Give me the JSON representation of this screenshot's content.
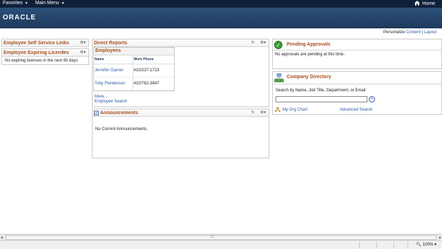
{
  "topbar": {
    "favorites": "Favorites",
    "main_menu": "Main Menu",
    "home": "Home"
  },
  "brand": {
    "logo": "ORACLE"
  },
  "personalize": {
    "label": "Personalize",
    "content": "Content",
    "separator": "|",
    "layout": "Layout"
  },
  "ess_links": {
    "title": "Employee Self Service Links"
  },
  "expiring": {
    "title": "Employee Expiring Licenses",
    "message": "No expiring licenses in the next 60 days"
  },
  "direct_reports": {
    "title": "Direct Reports",
    "table_title": "Employees",
    "columns": [
      "Name",
      "Work Phone"
    ],
    "rows": [
      {
        "name": "Jennifer Garner",
        "phone": "410/237-1723"
      },
      {
        "name": "Toby Flenderson",
        "phone": "410/762-3847"
      }
    ],
    "more": "More...",
    "employee_search": "Employee Search"
  },
  "announcements": {
    "title": "Announcements",
    "message": "No Current Announcements."
  },
  "pending": {
    "title": "Pending Approvals",
    "message": "No approvals are pending at this time."
  },
  "directory": {
    "title": "Company Directory",
    "search_label": "Search by Name, Job Title, Department, or Email",
    "my_org_chart": "My Org Chart",
    "advanced_search": "Advanced Search"
  },
  "statusbar": {
    "zoom": "100%"
  },
  "colors": {
    "topbar": "#11203a",
    "brand": "#24466c",
    "pagelet_title": "#a84d1d",
    "link": "#2a5aa3"
  }
}
